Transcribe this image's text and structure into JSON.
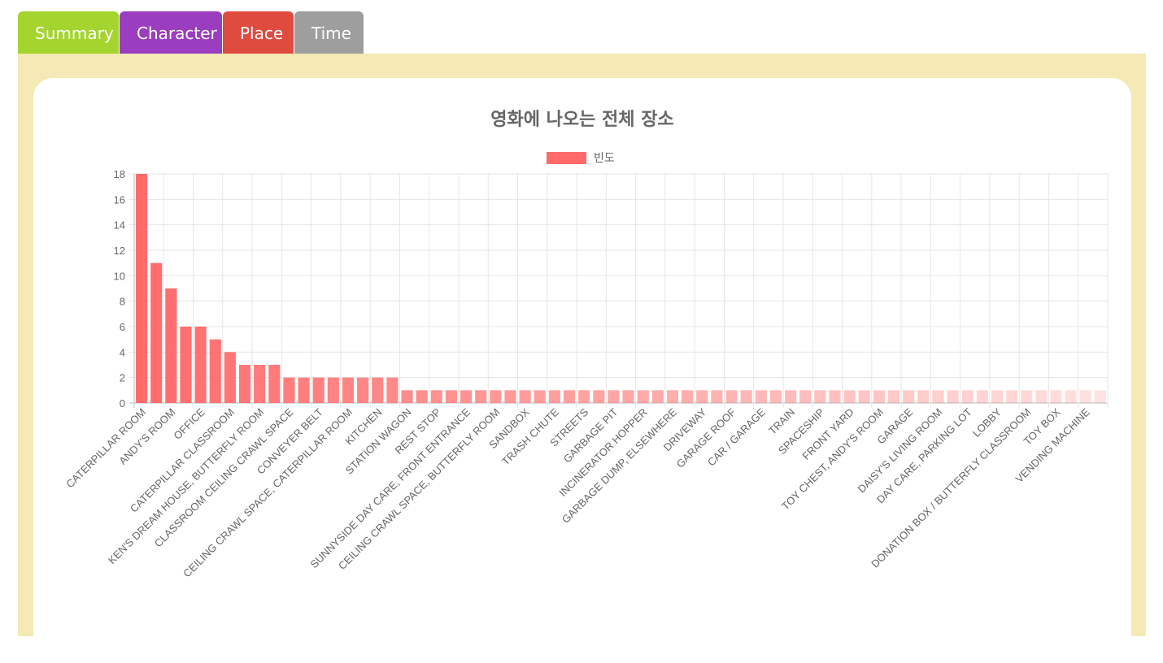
{
  "tabs": [
    {
      "label": "Summary",
      "color": "#a4d42e"
    },
    {
      "label": "Character",
      "color": "#9b3dbf"
    },
    {
      "label": "Place",
      "color": "#e04b40"
    },
    {
      "label": "Time",
      "color": "#9e9e9e"
    }
  ],
  "active_tab": "Place",
  "colors": {
    "panel_background": "#f5e9b5",
    "bar": "#ff6b6b"
  },
  "chart_data": {
    "type": "bar",
    "title": "영화에 나오는 전체 장소",
    "legend": "top",
    "ylim": [
      0,
      18
    ],
    "y_ticks": [
      0,
      2,
      4,
      6,
      8,
      10,
      12,
      14,
      16,
      18
    ],
    "grid": true,
    "bar_fade": "opacity decreases from left to right",
    "series": [
      {
        "name": "빈도",
        "values": [
          18,
          11,
          9,
          6,
          6,
          5,
          4,
          3,
          3,
          3,
          2,
          2,
          2,
          2,
          2,
          2,
          2,
          2,
          1,
          1,
          1,
          1,
          1,
          1,
          1,
          1,
          1,
          1,
          1,
          1,
          1,
          1,
          1,
          1,
          1,
          1,
          1,
          1,
          1,
          1,
          1,
          1,
          1,
          1,
          1,
          1,
          1,
          1,
          1,
          1,
          1,
          1,
          1,
          1,
          1,
          1,
          1,
          1,
          1,
          1,
          1,
          1,
          1,
          1,
          1,
          1
        ]
      }
    ],
    "categories": [
      "CATERPILLAR ROOM",
      "",
      "ANDY'S ROOM",
      "",
      "OFFICE",
      "",
      "CATERPILLAR CLASSROOM",
      "",
      "KEN'S DREAM HOUSE, BUTTERFLY ROOM",
      "",
      "CLASSROOM CEILING CRAWL SPACE",
      "",
      "CONVEYER BELT",
      "",
      "CEILING CRAWL SPACE, CATERPILLAR ROOM",
      "",
      "KITCHEN",
      "",
      "STATION WAGON",
      "",
      "REST STOP",
      "",
      "SUNNYSIDE DAY CARE, FRONT ENTRANCE",
      "",
      "CEILING CRAWL SPACE, BUTTERFLY ROOM",
      "",
      "SANDBOX",
      "",
      "TRASH CHUTE",
      "",
      "STREETS",
      "",
      "GARBAGE PIT",
      "",
      "INCINERATOR HOPPER",
      "",
      "GARBAGE DUMP, ELSEWHERE",
      "",
      "DRIVEWAY",
      "",
      "GARAGE ROOF",
      "",
      "CAR / GARAGE",
      "",
      "TRAIN",
      "",
      "SPACESHIP",
      "",
      "FRONT YARD",
      "",
      "TOY CHEST, ANDY'S ROOM",
      "",
      "GARAGE",
      "",
      "DAISY'S LIVING ROOM",
      "",
      "DAY CARE, PARKING LOT",
      "",
      "LOBBY",
      "",
      "DONATION BOX / BUTTERFLY CLASSROOM",
      "",
      "TOY BOX",
      "",
      "VENDING MACHINE",
      ""
    ]
  }
}
